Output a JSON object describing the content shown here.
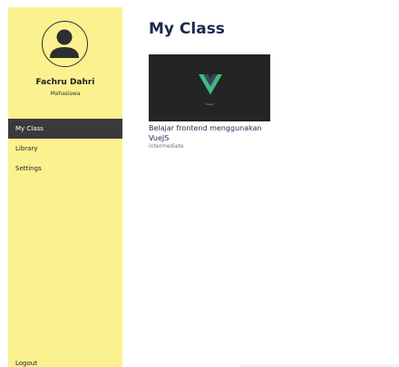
{
  "sidebar": {
    "profile": {
      "name": "Fachru Dahri",
      "role": "Mahasiswa",
      "avatar_icon": "user-avatar-icon"
    },
    "nav_items": [
      {
        "label": "My Class",
        "active": true
      },
      {
        "label": "Library",
        "active": false
      },
      {
        "label": "Settings",
        "active": false
      }
    ],
    "logout_label": "Logout"
  },
  "main": {
    "title": "My Class",
    "courses": [
      {
        "thumbnail_caption": "VueJs",
        "thumbnail_icon": "vue-logo-icon",
        "title": "Belajar frontend menggunakan VueJS",
        "level": "intermediate"
      }
    ]
  },
  "colors": {
    "sidebar_bg": "#fbf18f",
    "active_nav_bg": "#3a3a3a",
    "title_color": "#1d2a4d",
    "vue_green": "#41b883",
    "vue_dark": "#35495e"
  }
}
